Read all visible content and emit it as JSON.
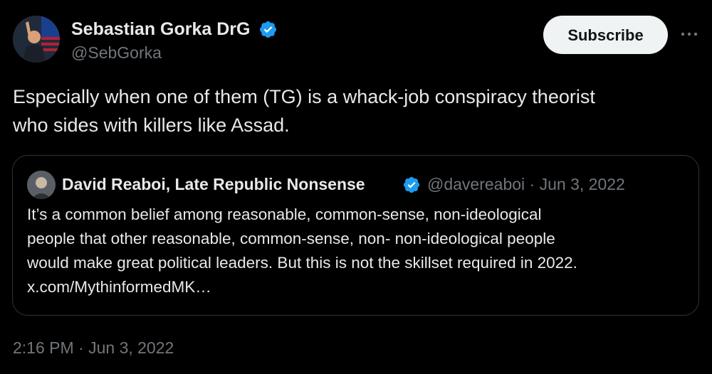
{
  "author": {
    "name": "Sebastian Gorka DrG",
    "handle": "@SebGorka",
    "verified_color": "#1d9bf0"
  },
  "actions": {
    "subscribe_label": "Subscribe",
    "more_icon": "more-horizontal-icon"
  },
  "tweet": {
    "text_lines": [
      "Especially when one of them (TG) is a whack-job conspiracy theorist",
      "who sides with killers like Assad."
    ],
    "timestamp": "2:16 PM · Jun 3, 2022"
  },
  "quote": {
    "name": "David Reaboi, Late Republic Nonsense",
    "handle": "@davereaboi",
    "separator": "·",
    "date": "Jun 3, 2022",
    "text_lines": [
      "It’s a common belief among reasonable, common-sense, non-ideological",
      "people that other reasonable, common-sense, non- non-ideological people",
      "would make great political leaders. But this is not the skillset required in 2022.",
      "x.com/MythinformedMK…"
    ]
  },
  "colors": {
    "background": "#000000",
    "text_primary": "#e7e9ea",
    "text_secondary": "#71767b",
    "border": "#2f3336",
    "button_bg": "#eff3f4",
    "verified": "#1d9bf0"
  }
}
